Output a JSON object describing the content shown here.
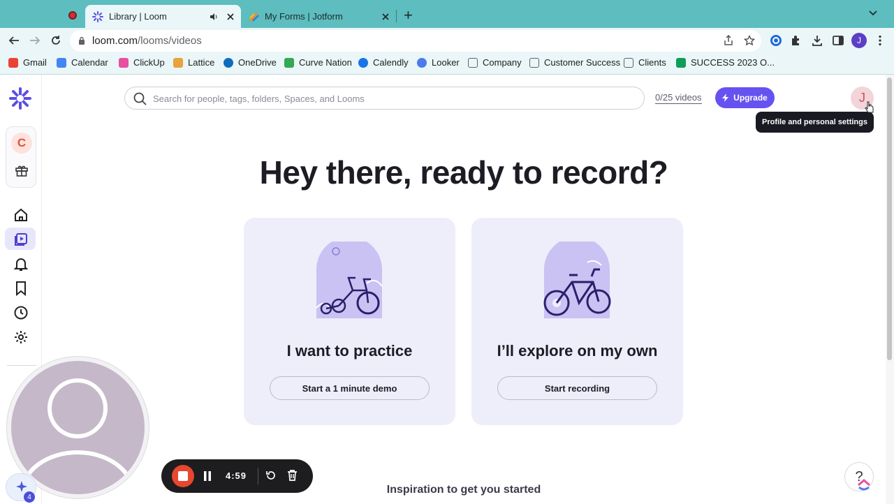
{
  "browser": {
    "tabs": [
      {
        "title": "Library | Loom",
        "active": true
      },
      {
        "title": "My Forms | Jotform",
        "active": false
      }
    ],
    "address": {
      "domain": "loom.com",
      "path": "/looms/videos"
    },
    "profile_initial": "J",
    "bookmarks": [
      {
        "label": "Gmail",
        "color": "#ea4335"
      },
      {
        "label": "Calendar",
        "color": "#4285f4"
      },
      {
        "label": "ClickUp",
        "color": "#e84fa0"
      },
      {
        "label": "Lattice",
        "color": "#e8a33c"
      },
      {
        "label": "OneDrive",
        "color": "#0f6cbd"
      },
      {
        "label": "Curve Nation",
        "color": "#34a853"
      },
      {
        "label": "Calendly",
        "color": "#1a73e8"
      },
      {
        "label": "Looker",
        "color": "#4b7bec"
      },
      {
        "label": "Company",
        "color": "#5f6368"
      },
      {
        "label": "Customer Success",
        "color": "#5f6368"
      },
      {
        "label": "Clients",
        "color": "#5f6368"
      },
      {
        "label": "SUCCESS 2023 O...",
        "color": "#0f9d58"
      }
    ]
  },
  "sidebar": {
    "workspace_initial": "C"
  },
  "topbar": {
    "search_placeholder": "Search for people, tags, folders, Spaces, and Looms",
    "videos_count": "0/25 videos",
    "upgrade_label": "Upgrade",
    "avatar_initial": "J",
    "tooltip": "Profile and personal settings"
  },
  "main": {
    "headline": "Hey there, ready to record?",
    "cards": [
      {
        "title": "I want to practice",
        "button": "Start a 1 minute demo"
      },
      {
        "title": "I’ll explore on my own",
        "button": "Start recording"
      }
    ],
    "section_heading": "Inspiration to get you started"
  },
  "recorder": {
    "timer": "4:59"
  },
  "notifications_badge": "4",
  "help_label": "?"
}
